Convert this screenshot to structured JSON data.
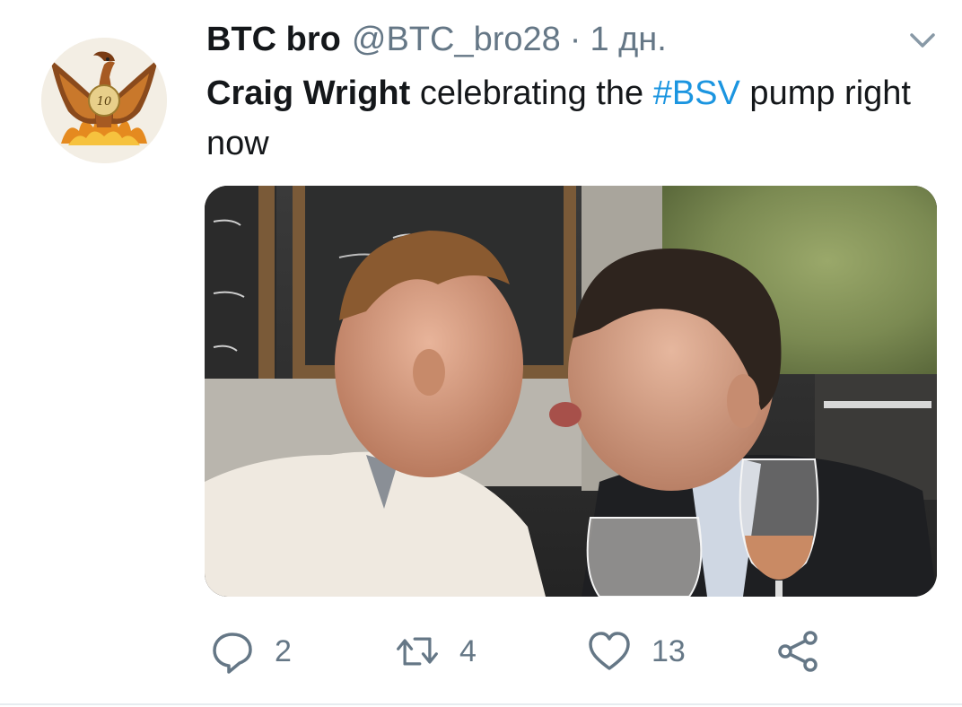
{
  "tweet": {
    "display_name": "BTC bro",
    "handle": "@BTC_bro28",
    "separator": "·",
    "time": "1 дн.",
    "text_name": "Craig Wright",
    "text_part1": " celebrating the ",
    "hashtag": "#BSV",
    "text_part2": " pump right now"
  },
  "actions": {
    "reply_count": "2",
    "retweet_count": "4",
    "like_count": "13"
  },
  "icons": {
    "avatar": "phoenix-logo-avatar",
    "menu": "chevron-down-icon",
    "reply": "reply-icon",
    "retweet": "retweet-icon",
    "like": "heart-icon",
    "share": "share-icon"
  },
  "colors": {
    "text": "#14171a",
    "secondary": "#657786",
    "link": "#1b95e0",
    "divider": "#e6ecf0"
  }
}
